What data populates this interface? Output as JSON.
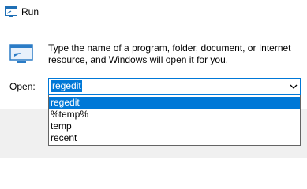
{
  "window": {
    "title": "Run",
    "title_icon": "run-icon"
  },
  "dialog": {
    "icon": "run-icon",
    "description": "Type the name of a program, folder, document, or Internet resource, and Windows will open it for you.",
    "open_label_accel": "O",
    "open_label_rest": "pen:",
    "open_value": "regedit",
    "dropdown_arrow_icon": "chevron-down-icon"
  },
  "history": {
    "items": [
      "regedit",
      "%temp%",
      "temp",
      "recent"
    ],
    "selected_index": 0
  },
  "colors": {
    "accent": "#0078d7",
    "footer": "#f0f0f0"
  }
}
